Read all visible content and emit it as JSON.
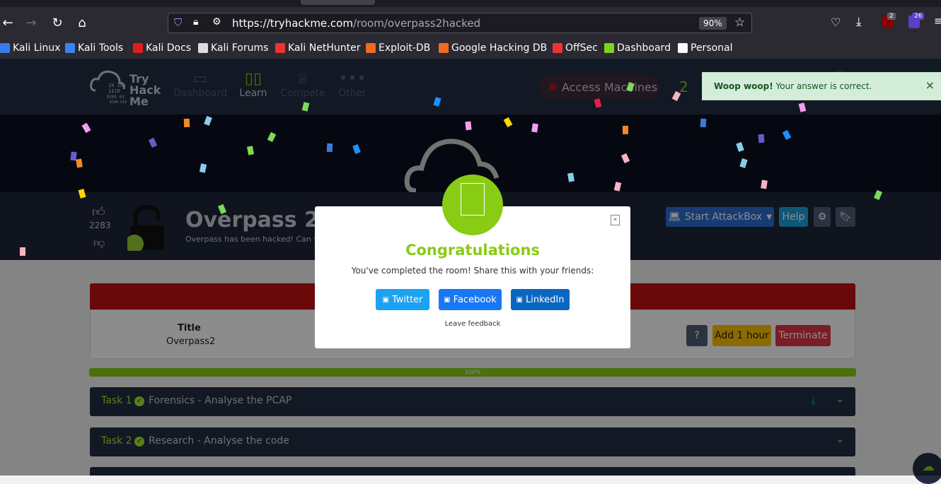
{
  "browser": {
    "url_host": "https://tryhackme.com",
    "url_path": "/room/overpass2hacked",
    "zoom": "90%",
    "badges": {
      "ublock": "2",
      "ext": "26"
    },
    "bookmarks": [
      {
        "label": "Kali Linux",
        "icon": "kali-icon",
        "color": "#367bf0"
      },
      {
        "label": "Kali Tools",
        "icon": "kali-tools-icon",
        "color": "#3b82f6"
      },
      {
        "label": "Kali Docs",
        "icon": "kali-docs-icon",
        "color": "#e11d1d"
      },
      {
        "label": "Kali Forums",
        "icon": "kali-forums-icon",
        "color": "#dddddd"
      },
      {
        "label": "Kali NetHunter",
        "icon": "nethunter-icon",
        "color": "#e33"
      },
      {
        "label": "Exploit-DB",
        "icon": "exploitdb-icon",
        "color": "#f06a22"
      },
      {
        "label": "Google Hacking DB",
        "icon": "ghdb-icon",
        "color": "#f06a22"
      },
      {
        "label": "OffSec",
        "icon": "offsec-icon",
        "color": "#e33"
      },
      {
        "label": "Dashboard",
        "icon": "dashboard-icon",
        "color": "#7ed321"
      },
      {
        "label": "Personal",
        "icon": "folder-icon",
        "color": "#fbfbfe"
      }
    ]
  },
  "header": {
    "logo_lines": [
      "Try",
      "Hack",
      "Me"
    ],
    "nav": [
      {
        "label": "Dashboard",
        "icon": "window-icon"
      },
      {
        "label": "Learn",
        "icon": "book-icon"
      },
      {
        "label": "Compete",
        "icon": "trophy-icon"
      },
      {
        "label": "Other",
        "icon": "more-icon"
      }
    ],
    "access_machines": "Access Machines",
    "streak": "2"
  },
  "toast": {
    "bold": "Woop woop!",
    "text": "Your answer is correct.",
    "close": "×"
  },
  "room": {
    "title": "Overpass 2 -",
    "subtitle": "Overpass has been hacked! Can y",
    "likes": "2283",
    "start_attackbox": "Start AttackBox",
    "help": "Help"
  },
  "machine": {
    "title_label": "Title",
    "title_value": "Overpass2",
    "question": "?",
    "add_hour": "Add 1 hour",
    "terminate": "Terminate"
  },
  "progress": {
    "value": 1.0,
    "label": "100%"
  },
  "tasks": [
    {
      "label": "Task 1",
      "title": "Forensics - Analyse the PCAP"
    },
    {
      "label": "Task 2",
      "title": "Research - Analyse the code"
    }
  ],
  "modal": {
    "heading": "Congratulations",
    "message": "You've completed the room! Share this with your friends:",
    "twitter": "Twitter",
    "facebook": "Facebook",
    "linkedin": "LinkedIn",
    "feedback": "Leave feedback"
  },
  "colors": {
    "thm_green": "#88cc14",
    "twitter": "#1da1f2",
    "facebook": "#1877f2",
    "linkedin": "#0a66c2",
    "progress": "#88cc14",
    "terminate": "#dc3545",
    "add_hour": "#ffc107"
  }
}
